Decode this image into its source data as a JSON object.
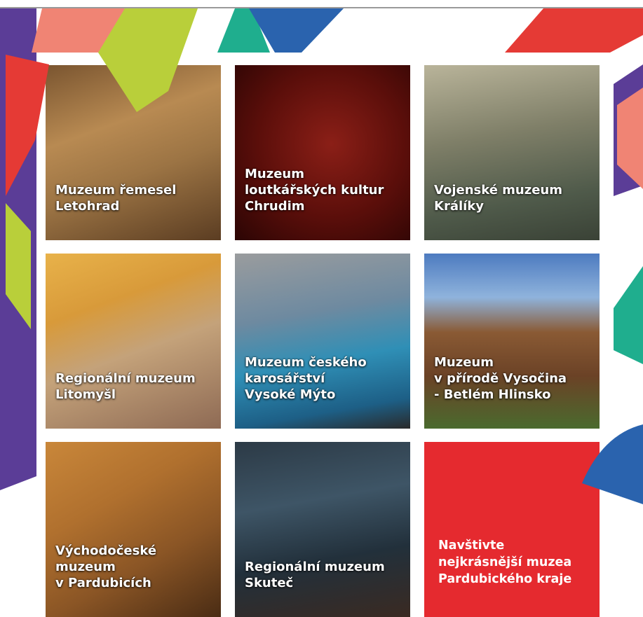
{
  "colors": {
    "brand_red": "#e53a35",
    "purple": "#5b3d97",
    "lime": "#b9cf3a",
    "salmon": "#f08474",
    "teal": "#1fae8e",
    "blue": "#2a63ae"
  },
  "tiles": [
    {
      "id": "letohrad",
      "lines": [
        "Muzeum řemesel",
        "Letohrad"
      ]
    },
    {
      "id": "chrudim",
      "lines": [
        "Muzeum",
        "loutkářských kultur",
        "Chrudim"
      ]
    },
    {
      "id": "kraliky",
      "lines": [
        "Vojenské muzeum",
        "Králíky"
      ]
    },
    {
      "id": "litomysl",
      "lines": [
        "Regionální muzeum",
        "Litomyšl"
      ]
    },
    {
      "id": "vysoke-myto",
      "lines": [
        "Muzeum českého",
        "karosářství",
        "Vysoké Mýto"
      ]
    },
    {
      "id": "hlinsko",
      "lines": [
        "Muzeum",
        "v přírodě Vysočina",
        "- Betlém Hlinsko"
      ]
    },
    {
      "id": "pardubice",
      "lines": [
        " Východočeské",
        "muzeum",
        "v Pardubicích"
      ]
    },
    {
      "id": "skutec",
      "lines": [
        "Regionální muzeum",
        "Skuteč"
      ]
    },
    {
      "id": "promo",
      "lines": [
        "Navštivte",
        "nejkrásnější muzea",
        "Pardubického kraje"
      ]
    }
  ]
}
